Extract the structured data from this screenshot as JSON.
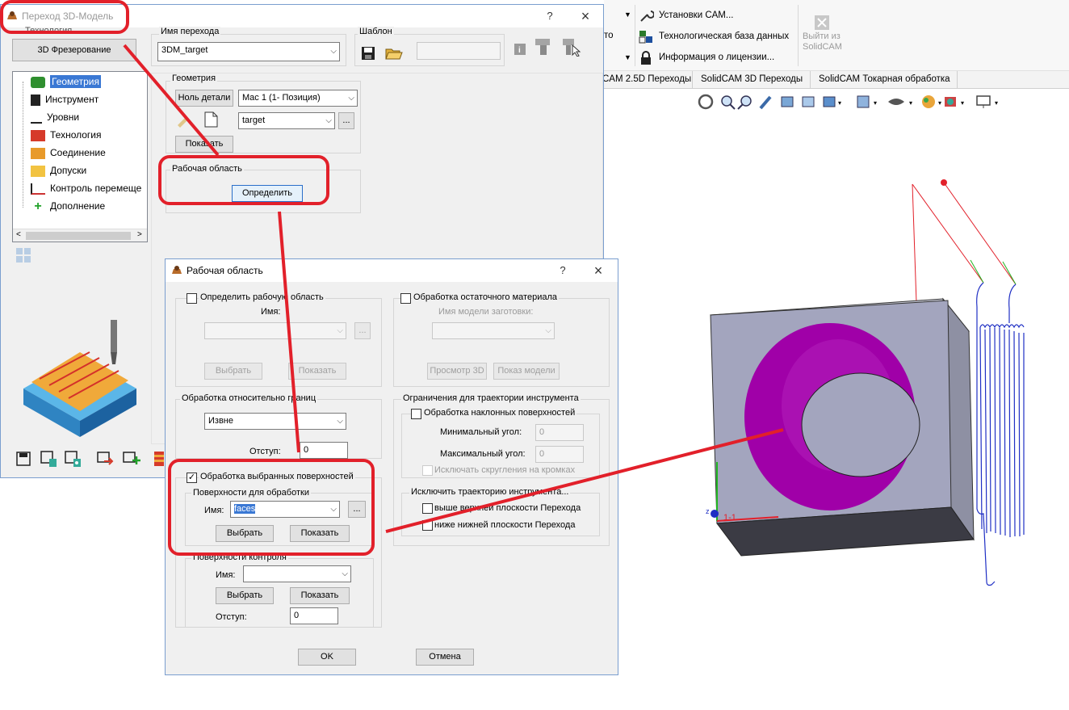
{
  "background_app": {
    "ribbon": {
      "items": [
        "Установки CAM...",
        "Технологическая база данных",
        "Информация о лицензии..."
      ],
      "exit_label": "Выйти из SolidCAM",
      "partial_left": "то"
    },
    "tabs": [
      "CAM 2.5D Переходы",
      "SolidCAM 3D Переходы",
      "SolidCAM Токарная обработка"
    ],
    "colors": {
      "part_gray": "#a3a5be",
      "cavity_purple": "#a000a8",
      "toolpath_blue": "#1f2fc4",
      "annotation_red": "#e2202a"
    }
  },
  "main_dialog": {
    "title": "Переход 3D-Модель",
    "help_label": "?",
    "close_label": "×",
    "technology_group_label": "Технология",
    "technology_button": "3D Фрезерование",
    "operation_name_label": "Имя перехода",
    "operation_name_value": "3DM_target",
    "template_label": "Шаблон",
    "geometry_group_label": "Геометрия",
    "part_zero_button": "Ноль детали",
    "position_value": "Mac 1 (1- Позиция)",
    "geometry_value": "target",
    "ellipsis": "...",
    "show_button": "Показать",
    "work_area_group_label": "Рабочая область",
    "define_button": "Определить",
    "tree_items": [
      "Геометрия",
      "Инструмент",
      "Уровни",
      "Технология",
      "Соединение",
      "Допуски",
      "Контроль перемеще",
      "Дополнение"
    ]
  },
  "work_area_dialog": {
    "title": "Рабочая область",
    "help_label": "?",
    "close_label": "×",
    "define_area_checkbox": "Определить рабочую область",
    "name_label": "Имя:",
    "select_button": "Выбрать",
    "show_button": "Показать",
    "rest_material_checkbox": "Обработка остаточного материала",
    "stock_model_name_label": "Имя модели заготовки:",
    "preview_3d_button": "Просмотр 3D",
    "show_model_button": "Показ модели",
    "boundary_group_label": "Обработка относительно границ",
    "boundary_value": "Извне",
    "offset_label": "Отступ:",
    "offset_value": "0",
    "toolpath_limits_label": "Ограничения для траектории инструмента",
    "inclined_checkbox": "Обработка наклонных поверхностей",
    "min_angle_label": "Минимальный угол:",
    "min_angle_value": "0",
    "max_angle_label": "Максимальный угол:",
    "max_angle_value": "0",
    "exclude_fillets_label": "Исключать скругления на кромках",
    "selected_faces_checkbox": "Обработка выбранных поверхностей",
    "drive_surfaces_label": "Поверхности для обработки",
    "drive_name_value": "faces",
    "ellipsis": "...",
    "exclude_toolpath_label": "Исключить траекторию инструмента...",
    "above_upper_label": "выше верхней плоскости Перехода",
    "below_lower_label": "ниже нижней плоскости Перехода",
    "check_surfaces_label": "Поверхности контроля",
    "check_offset_value": "0",
    "ok_button": "OK",
    "cancel_button": "Отмена"
  },
  "viewport": {
    "axis_label": "1-1",
    "z_label": "z"
  }
}
